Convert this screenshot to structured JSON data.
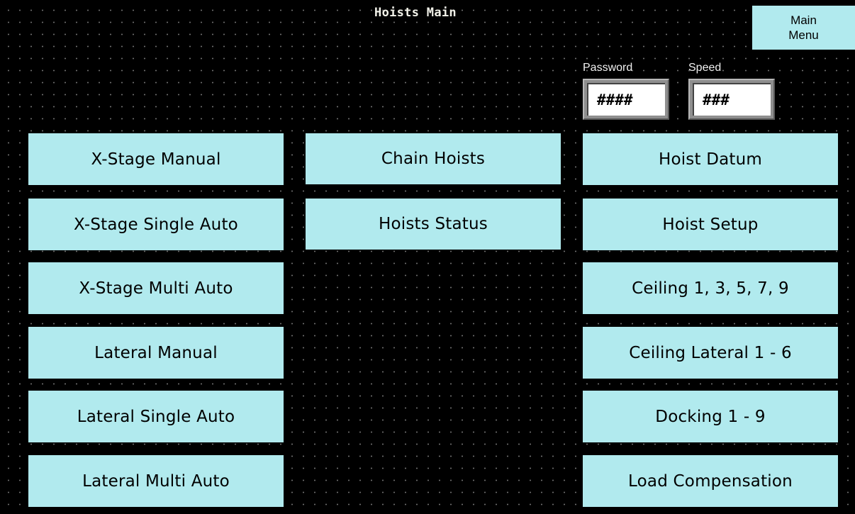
{
  "header": {
    "title": "Hoists Main",
    "main_menu_label": "Main\nMenu"
  },
  "fields": {
    "password": {
      "label": "Password",
      "value": "####"
    },
    "speed": {
      "label": "Speed",
      "value": "###"
    }
  },
  "buttons": {
    "left": [
      "X-Stage Manual",
      "X-Stage Single Auto",
      "X-Stage Multi Auto",
      "Lateral Manual",
      "Lateral Single Auto",
      "Lateral Multi Auto"
    ],
    "middle": [
      "Chain Hoists",
      "Hoists Status"
    ],
    "right": [
      "Hoist Datum",
      "Hoist Setup",
      "Ceiling 1, 3, 5, 7, 9",
      "Ceiling Lateral 1 - 6",
      "Docking 1 - 9",
      "Load Compensation"
    ]
  },
  "colors": {
    "background": "#000000",
    "button": "#b1eaee",
    "grid_dot": "#7a7a7a",
    "title_text": "#f3f3ea"
  }
}
